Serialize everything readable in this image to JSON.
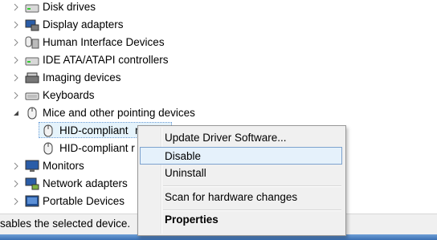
{
  "tree": {
    "items": [
      {
        "label": "Disk drives",
        "icon": "disk-drive-icon",
        "expanded": false
      },
      {
        "label": "Display adapters",
        "icon": "display-adapter-icon",
        "expanded": false
      },
      {
        "label": "Human Interface Devices",
        "icon": "hid-icon",
        "expanded": false
      },
      {
        "label": "IDE ATA/ATAPI controllers",
        "icon": "ide-controller-icon",
        "expanded": false
      },
      {
        "label": "Imaging devices",
        "icon": "imaging-device-icon",
        "expanded": false
      },
      {
        "label": "Keyboards",
        "icon": "keyboard-icon",
        "expanded": false
      },
      {
        "label": "Mice and other pointing devices",
        "icon": "mouse-icon",
        "expanded": true
      },
      {
        "label": "HID-compliant mouse",
        "icon": "mouse-icon",
        "child": true,
        "selected": true
      },
      {
        "label": "HID-compliant m",
        "icon": "mouse-icon",
        "child": true
      },
      {
        "label": "Monitors",
        "icon": "monitor-icon",
        "expanded": false
      },
      {
        "label": "Network adapters",
        "icon": "network-adapter-icon",
        "expanded": false
      },
      {
        "label": "Portable Devices",
        "icon": "portable-device-icon",
        "expanded": false
      }
    ],
    "child_1_visible": "HID-compliant",
    "child_1_clip": "n",
    "child_2_visible": "HID-compliant r"
  },
  "status_bar": {
    "text": "sables the selected device."
  },
  "context_menu": {
    "items": [
      {
        "label": "Update Driver Software...",
        "highlighted": false
      },
      {
        "label": "Disable",
        "highlighted": true
      },
      {
        "label": "Uninstall",
        "highlighted": false
      },
      {
        "label": "Scan for hardware changes",
        "highlighted": false
      },
      {
        "label": "Properties",
        "highlighted": false,
        "bold": true
      }
    ]
  },
  "colors": {
    "selection": "#e5f3fb",
    "menu_highlight": "#e5f1fb",
    "menu_border": "#979797",
    "taskbar": "#4a7fc1"
  }
}
